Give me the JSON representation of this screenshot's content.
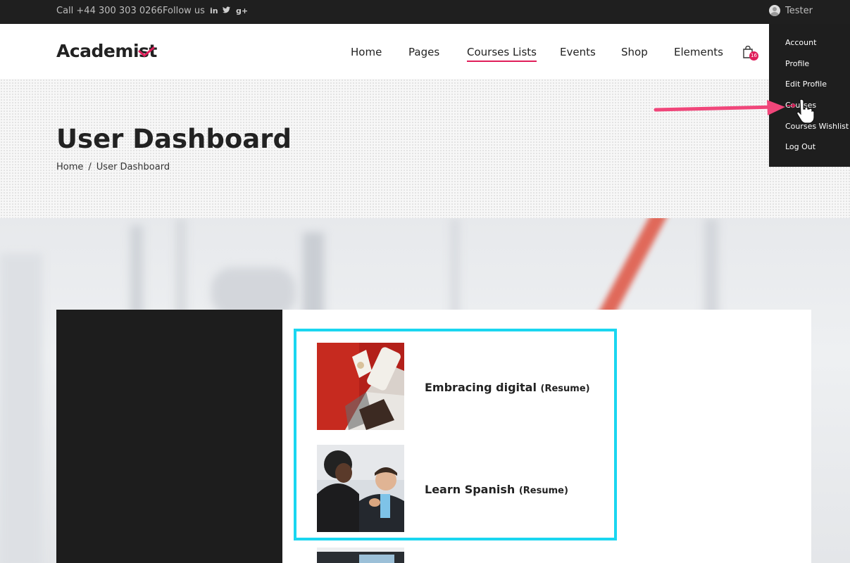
{
  "topbar": {
    "phone": "Call +44 300 303 0266",
    "follow_label": "Follow us",
    "social_icons": [
      "linkedin-icon",
      "twitter-icon",
      "googleplus-icon"
    ],
    "user_name": "Tester"
  },
  "header": {
    "logo": "Academist",
    "nav": [
      "Home",
      "Pages",
      "Courses Lists",
      "Events",
      "Shop",
      "Elements"
    ],
    "active_nav": "Courses Lists",
    "cart_count": "16"
  },
  "hero": {
    "title": "User Dashboard",
    "breadcrumb": [
      "Home",
      "/",
      "User Dashboard"
    ]
  },
  "user_menu": [
    "Account",
    "Profile",
    "Edit Profile",
    "Courses",
    "Courses Wishlist",
    "Log Out"
  ],
  "courses": [
    {
      "title": "Embracing digital",
      "action": "Resume"
    },
    {
      "title": "Learn Spanish",
      "action": "Resume"
    }
  ],
  "colors": {
    "accent": "#e01e5a",
    "highlight": "#1ad6f0",
    "dark": "#1f1f1f"
  }
}
